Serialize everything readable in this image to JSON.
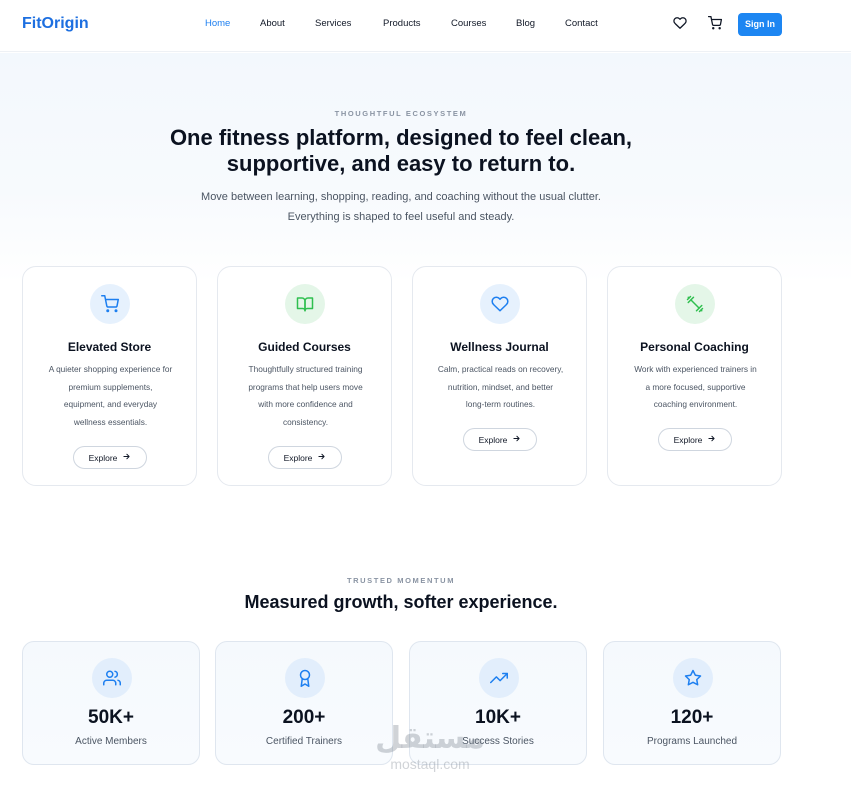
{
  "nav": {
    "logo": "FitOrigin",
    "links": [
      "Home",
      "About",
      "Services",
      "Products",
      "Courses",
      "Blog",
      "Contact"
    ],
    "active": "Home",
    "sign_in": "Sign In",
    "icons": [
      "heart-icon",
      "cart-icon"
    ]
  },
  "hero": {
    "eyebrow": "THOUGHTFUL ECOSYSTEM",
    "title_line1": "One fitness platform, designed to feel clean,",
    "title_line2": "supportive, and easy to return to.",
    "sub_line1": "Move between learning, shopping, reading, and coaching without the usual clutter.",
    "sub_line2": "Everything is shaped to feel useful and steady."
  },
  "features": [
    {
      "icon": "cart-icon",
      "title": "Elevated Store",
      "desc": [
        "A quieter shopping experience for",
        "premium supplements,",
        "equipment, and everyday",
        "wellness essentials."
      ],
      "button": "Explore"
    },
    {
      "icon": "book-icon",
      "title": "Guided Courses",
      "desc": [
        "Thoughtfully structured training",
        "programs that help users move",
        "with more confidence and",
        "consistency."
      ],
      "button": "Explore"
    },
    {
      "icon": "heart-icon",
      "title": "Wellness Journal",
      "desc": [
        "Calm, practical reads on recovery,",
        "nutrition, mindset, and better",
        "long-term routines."
      ],
      "button": "Explore"
    },
    {
      "icon": "dumbbell-icon",
      "title": "Personal Coaching",
      "desc": [
        "Work with experienced trainers in",
        "a more focused, supportive",
        "coaching environment."
      ],
      "button": "Explore"
    }
  ],
  "stats_section": {
    "eyebrow": "TRUSTED MOMENTUM",
    "title": "Measured growth, softer experience.",
    "items": [
      {
        "icon": "users-icon",
        "value": "50K+",
        "label": "Active Members"
      },
      {
        "icon": "award-icon",
        "value": "200+",
        "label": "Certified Trainers"
      },
      {
        "icon": "trending-up-icon",
        "value": "10K+",
        "label": "Success Stories"
      },
      {
        "icon": "star-icon",
        "value": "120+",
        "label": "Programs Launched"
      }
    ]
  },
  "watermark": {
    "arabic": "مستقل",
    "latin": "mostaql.com"
  },
  "colors": {
    "brand": "#1d6fe0",
    "primary_button": "#1d86f2",
    "icon_blue": "#1d7ff0",
    "icon_green": "#2fbf4f"
  }
}
